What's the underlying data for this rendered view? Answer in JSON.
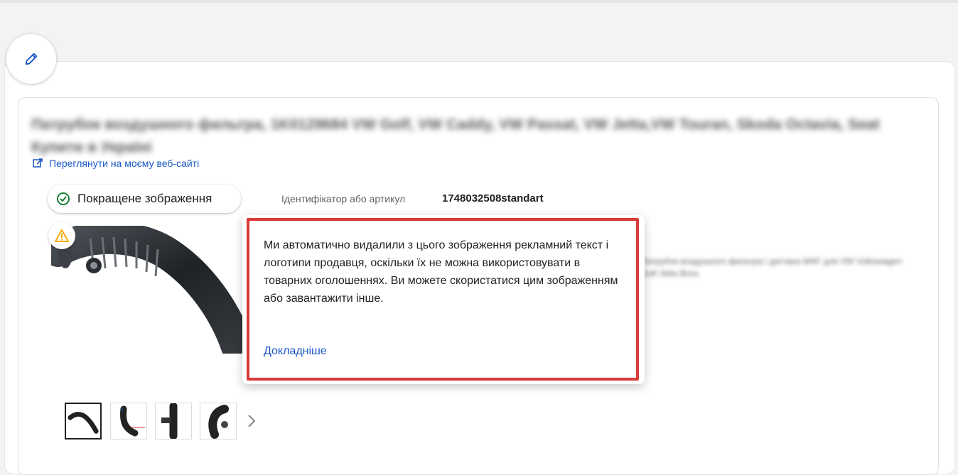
{
  "product": {
    "title_blurred": "Патрубок воздушного фильтра, 1K0129684 VW Golf, VW Caddy, VW Passat, VW Jetta,VW Touran, Skoda Octavia, Seat Купити в Україні",
    "view_on_site_label": "Переглянути на моєму веб-сайті",
    "enhanced_image_chip": "Покращене зображення",
    "id_label": "Ідентифікатор або артикул",
    "id_value": "1748032508standart",
    "description_blurred": "Патрубок воздушного фильтра і датчика MAF для VW Volkswagen Golf Jetta Bora."
  },
  "popup": {
    "message": "Ми автоматично видалили з цього зображення рекламний текст і логотипи продавця, оскільки їх не можна використовувати в товарних оголошеннях. Ви можете скористатися цим зображенням або завантажити інше.",
    "learn_more": "Докладніше",
    "highlight_color": "#d93a3a"
  },
  "icons": {
    "edit": "pencil-icon",
    "external_link": "open-in-new-icon",
    "check": "check-circle-icon",
    "warning": "warning-icon",
    "next": "chevron-right-icon"
  },
  "thumbnails": {
    "count": 4,
    "selected_index": 0
  },
  "colors": {
    "link": "#1a57c6",
    "success": "#188038",
    "warning": "#f9ab00"
  }
}
